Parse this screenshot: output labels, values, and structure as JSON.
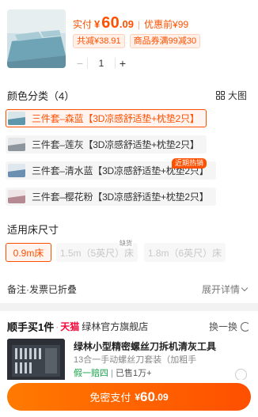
{
  "product": {
    "price_label": "实付",
    "currency": "¥",
    "price_int": "60",
    "price_dec": ".09",
    "separator": "|",
    "promo": "优惠前¥99",
    "tag_discount": "共减¥38.91",
    "tag_coupon": "商品券满99减30",
    "quantity": "1",
    "minus": "−",
    "plus": "+"
  },
  "color_section": {
    "title": "颜色分类（4）",
    "big_view_label": "大图",
    "options": [
      {
        "label": "三件套–森蓝【3D凉感舒适垫+枕垫2只】",
        "selected": true
      },
      {
        "label": "三件套–莲灰【3D凉感舒适垫+枕垫2只】",
        "selected": false
      },
      {
        "label": "三件套–清水蓝【3D凉感舒适垫+枕垫2只】",
        "selected": false
      },
      {
        "label": "三件套–樱花粉【3D凉感舒适垫+枕垫2只】",
        "selected": false
      }
    ],
    "hot_badge": "近期热销"
  },
  "size_section": {
    "title": "适用床尺寸",
    "options": [
      {
        "label": "0.9m床",
        "state": "selected"
      },
      {
        "label": "1.5m（5英尺）床",
        "state": "disabled"
      },
      {
        "label": "1.8m（6英尺）床",
        "state": "disabled"
      }
    ],
    "stock_out_label": "缺货"
  },
  "remark": {
    "label": "备注·发票已折叠",
    "expand_label": "展开详情"
  },
  "buy_along": {
    "title": "顺手买1件",
    "dot": "·",
    "brand": "天猫",
    "shop": "绿林官方旗舰店",
    "swap_label": "换一换",
    "item_title": "绿林小型精密螺丝刀拆机清灰工具",
    "item_sub": "13合一手动螺丝刀套装（加粗手",
    "gift": "假一赔四",
    "sep": "|",
    "sold": "已售1万+"
  },
  "pay": {
    "label": "免密支付",
    "currency": "¥",
    "int": "60",
    "dec": ".09"
  },
  "colors": {
    "accent": "#ff5000",
    "tmall": "#ff0036"
  }
}
